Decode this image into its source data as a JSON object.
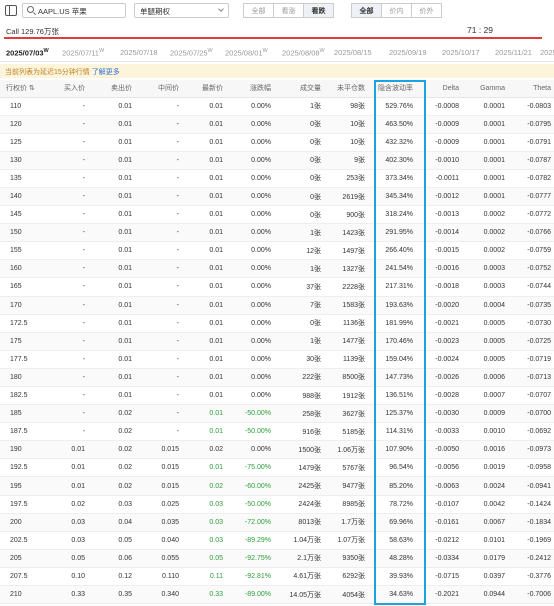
{
  "toolbar": {
    "search_value": "AAPL.US 苹果",
    "select_value": "单腿期权",
    "filter1": [
      "全部",
      "看涨",
      "看跌"
    ],
    "filter1_active": 2,
    "filter2": [
      "全部",
      "价内",
      "价外"
    ],
    "filter2_active": 0
  },
  "callbar": {
    "label": "Call  129.76万张",
    "time": "71 : 29"
  },
  "dates": [
    {
      "label": "2025/07/03",
      "sup": "W",
      "active": true
    },
    {
      "label": "2025/07/11",
      "sup": "W",
      "active": false
    },
    {
      "label": "2025/07/18",
      "sup": "",
      "active": false
    },
    {
      "label": "2025/07/25",
      "sup": "W",
      "active": false
    },
    {
      "label": "2025/08/01",
      "sup": "W",
      "active": false
    },
    {
      "label": "2025/08/08",
      "sup": "W",
      "active": false
    },
    {
      "label": "2025/08/15",
      "sup": "",
      "active": false
    },
    {
      "label": "2025/09/19",
      "sup": "",
      "active": false
    },
    {
      "label": "2025/10/17",
      "sup": "",
      "active": false
    },
    {
      "label": "2025/11/21",
      "sup": "",
      "active": false
    },
    {
      "label": "2025",
      "sup": "",
      "active": false
    }
  ],
  "notice": {
    "text": "当前列表为延迟15分钟行情 ",
    "link": "了解更多"
  },
  "table": {
    "headers": [
      "行权价 ⇅",
      "买入价",
      "卖出价",
      "中间价",
      "最新价",
      "涨跌幅",
      "成交量",
      "未平仓数",
      "隐含波动率",
      "Delta",
      "Gamma",
      "Theta"
    ],
    "rows": [
      [
        "110",
        "-",
        "0.01",
        "-",
        "0.01",
        "0.00%",
        "1张",
        "98张",
        "529.76%",
        "-0.0008",
        "0.0001",
        "-0.0803"
      ],
      [
        "120",
        "-",
        "0.01",
        "-",
        "0.01",
        "0.00%",
        "0张",
        "10张",
        "463.50%",
        "-0.0009",
        "0.0001",
        "-0.0795"
      ],
      [
        "125",
        "-",
        "0.01",
        "-",
        "0.01",
        "0.00%",
        "0张",
        "10张",
        "432.32%",
        "-0.0009",
        "0.0001",
        "-0.0791"
      ],
      [
        "130",
        "-",
        "0.01",
        "-",
        "0.01",
        "0.00%",
        "0张",
        "9张",
        "402.30%",
        "-0.0010",
        "0.0001",
        "-0.0787"
      ],
      [
        "135",
        "-",
        "0.01",
        "-",
        "0.01",
        "0.00%",
        "0张",
        "253张",
        "373.34%",
        "-0.0011",
        "0.0001",
        "-0.0782"
      ],
      [
        "140",
        "-",
        "0.01",
        "-",
        "0.01",
        "0.00%",
        "0张",
        "2619张",
        "345.34%",
        "-0.0012",
        "0.0001",
        "-0.0777"
      ],
      [
        "145",
        "-",
        "0.01",
        "-",
        "0.01",
        "0.00%",
        "0张",
        "900张",
        "318.24%",
        "-0.0013",
        "0.0002",
        "-0.0772"
      ],
      [
        "150",
        "-",
        "0.01",
        "-",
        "0.01",
        "0.00%",
        "1张",
        "1423张",
        "291.95%",
        "-0.0014",
        "0.0002",
        "-0.0766"
      ],
      [
        "155",
        "-",
        "0.01",
        "-",
        "0.01",
        "0.00%",
        "12张",
        "1497张",
        "266.40%",
        "-0.0015",
        "0.0002",
        "-0.0759"
      ],
      [
        "160",
        "-",
        "0.01",
        "-",
        "0.01",
        "0.00%",
        "1张",
        "1327张",
        "241.54%",
        "-0.0016",
        "0.0003",
        "-0.0752"
      ],
      [
        "165",
        "-",
        "0.01",
        "-",
        "0.01",
        "0.00%",
        "37张",
        "2228张",
        "217.31%",
        "-0.0018",
        "0.0003",
        "-0.0744"
      ],
      [
        "170",
        "-",
        "0.01",
        "-",
        "0.01",
        "0.00%",
        "7张",
        "1583张",
        "193.63%",
        "-0.0020",
        "0.0004",
        "-0.0735"
      ],
      [
        "172.5",
        "-",
        "0.01",
        "-",
        "0.01",
        "0.00%",
        "0张",
        "1136张",
        "181.99%",
        "-0.0021",
        "0.0005",
        "-0.0730"
      ],
      [
        "175",
        "-",
        "0.01",
        "-",
        "0.01",
        "0.00%",
        "1张",
        "1477张",
        "170.46%",
        "-0.0023",
        "0.0005",
        "-0.0725"
      ],
      [
        "177.5",
        "-",
        "0.01",
        "-",
        "0.01",
        "0.00%",
        "30张",
        "1139张",
        "159.04%",
        "-0.0024",
        "0.0005",
        "-0.0719"
      ],
      [
        "180",
        "-",
        "0.01",
        "-",
        "0.01",
        "0.00%",
        "222张",
        "8500张",
        "147.73%",
        "-0.0026",
        "0.0006",
        "-0.0713"
      ],
      [
        "182.5",
        "-",
        "0.01",
        "-",
        "0.01",
        "0.00%",
        "988张",
        "1912张",
        "136.51%",
        "-0.0028",
        "0.0007",
        "-0.0707"
      ],
      [
        "185",
        "-",
        "0.02",
        "-",
        "0.01",
        "-50.00%",
        "258张",
        "3627张",
        "125.37%",
        "-0.0030",
        "0.0009",
        "-0.0700"
      ],
      [
        "187.5",
        "-",
        "0.02",
        "-",
        "0.01",
        "-50.00%",
        "916张",
        "5185张",
        "114.31%",
        "-0.0033",
        "0.0010",
        "-0.0692"
      ],
      [
        "190",
        "0.01",
        "0.02",
        "0.015",
        "0.02",
        "0.00%",
        "1500张",
        "1.06万张",
        "107.90%",
        "-0.0050",
        "0.0016",
        "-0.0973"
      ],
      [
        "192.5",
        "0.01",
        "0.02",
        "0.015",
        "0.01",
        "-75.00%",
        "1479张",
        "5767张",
        "96.54%",
        "-0.0056",
        "0.0019",
        "-0.0958"
      ],
      [
        "195",
        "0.01",
        "0.02",
        "0.015",
        "0.02",
        "-60.00%",
        "2425张",
        "9477张",
        "85.20%",
        "-0.0063",
        "0.0024",
        "-0.0941"
      ],
      [
        "197.5",
        "0.02",
        "0.03",
        "0.025",
        "0.03",
        "-50.00%",
        "2424张",
        "8985张",
        "78.72%",
        "-0.0107",
        "0.0042",
        "-0.1424"
      ],
      [
        "200",
        "0.03",
        "0.04",
        "0.035",
        "0.03",
        "-72.00%",
        "8013张",
        "1.7万张",
        "69.96%",
        "-0.0161",
        "0.0067",
        "-0.1834"
      ],
      [
        "202.5",
        "0.03",
        "0.05",
        "0.040",
        "0.03",
        "-89.29%",
        "1.04万张",
        "1.07万张",
        "58.63%",
        "-0.0212",
        "0.0101",
        "-0.1969"
      ],
      [
        "205",
        "0.05",
        "0.06",
        "0.055",
        "0.05",
        "-92.75%",
        "2.1万张",
        "9350张",
        "48.28%",
        "-0.0334",
        "0.0179",
        "-0.2412"
      ],
      [
        "207.5",
        "0.10",
        "0.12",
        "0.110",
        "0.11",
        "-92.81%",
        "4.61万张",
        "6292张",
        "39.93%",
        "-0.0715",
        "0.0397",
        "-0.3776"
      ],
      [
        "210",
        "0.33",
        "0.35",
        "0.340",
        "0.33",
        "-89.00%",
        "14.05万张",
        "4054张",
        "34.63%",
        "-0.2021",
        "0.0944",
        "-0.7006"
      ]
    ]
  },
  "colors": {
    "accent_red": "#e03c3c",
    "highlight_blue": "#1aa3dc",
    "down_green": "#2e9d3a"
  }
}
